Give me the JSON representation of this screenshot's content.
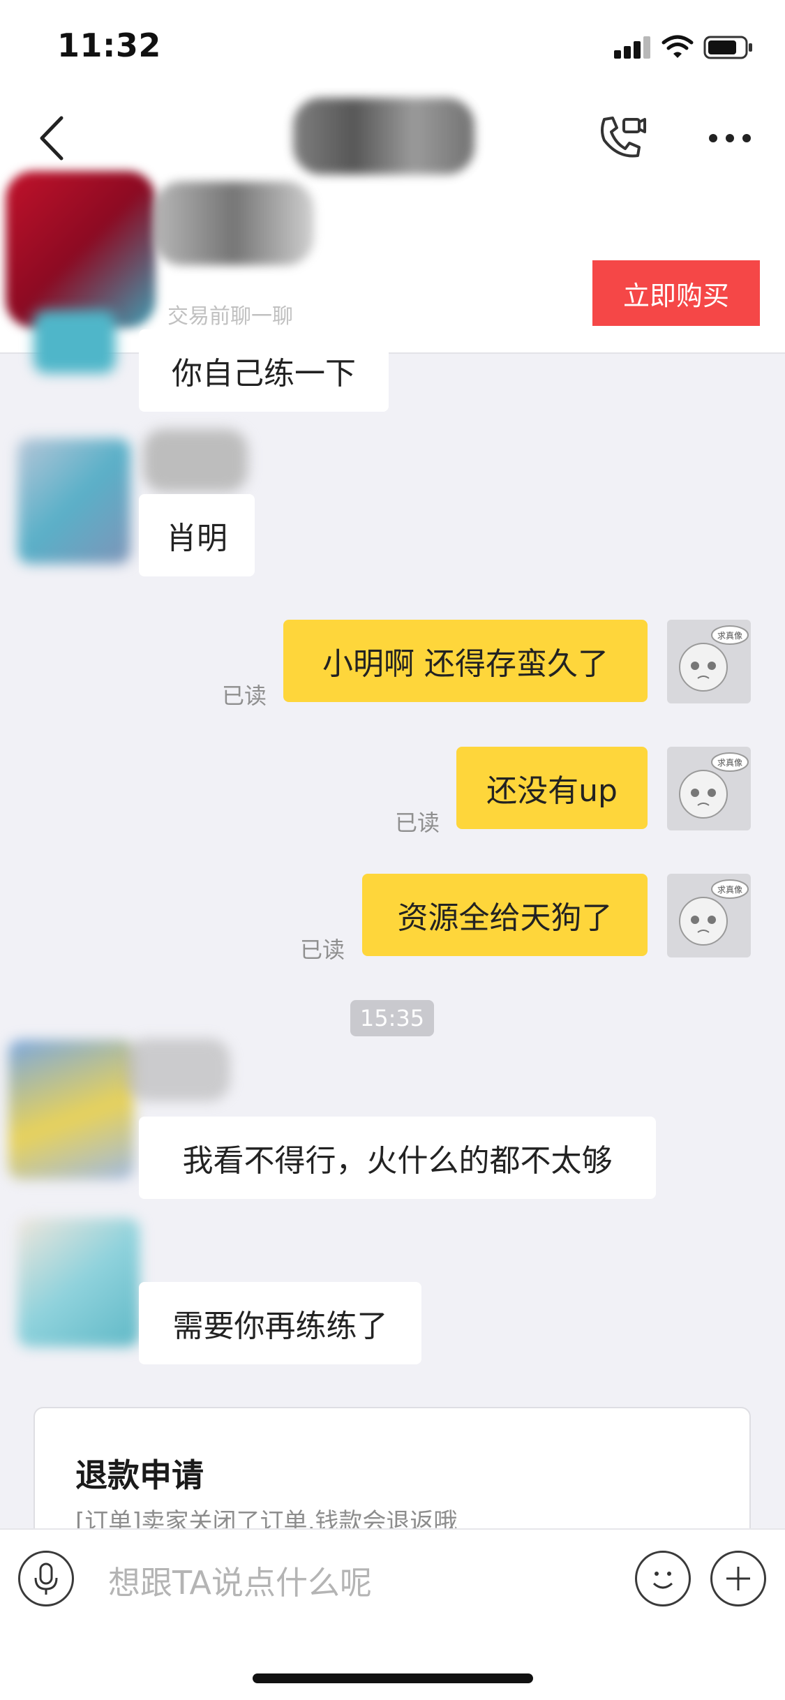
{
  "status_bar": {
    "time": "11:32"
  },
  "header": {
    "buy_button": "立即购买",
    "sub_label": "交易前聊一聊"
  },
  "messages": [
    {
      "side": "left",
      "text": "你自己练一下"
    },
    {
      "side": "left",
      "text": "肖明"
    },
    {
      "side": "right",
      "text": "小明啊 还得存蛮久了",
      "status": "已读"
    },
    {
      "side": "right",
      "text": "还没有up",
      "status": "已读"
    },
    {
      "side": "right",
      "text": "资源全给天狗了",
      "status": "已读"
    },
    {
      "side": "left",
      "text": "我看不得行，火什么的都不太够"
    },
    {
      "side": "left",
      "text": "需要你再练练了"
    }
  ],
  "timestamp": "15:35",
  "avatar_badge": "求真像",
  "refund_card": {
    "title": "退款申请",
    "description": "[订单]卖家关闭了订单,钱款会退返哦"
  },
  "input": {
    "placeholder": "想跟TA说点什么呢"
  },
  "colors": {
    "background": "#f1f1f6",
    "my_bubble": "#fed63b",
    "buy_button": "#f54747"
  }
}
